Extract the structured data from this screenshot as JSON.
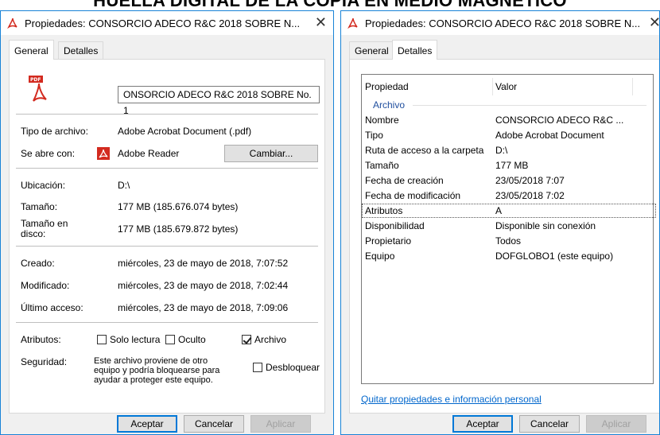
{
  "banner": "HUELLA DIGITAL DE LA COPIA EN MEDIO MAGNÉTICO",
  "left_window": {
    "title": "Propiedades: CONSORCIO ADECO R&C 2018 SOBRE N...",
    "tabs": [
      "General",
      "Detalles"
    ],
    "file_name": "ONSORCIO ADECO R&C 2018 SOBRE No. 1",
    "rows": {
      "tipo_label": "Tipo de archivo:",
      "tipo_value": "Adobe Acrobat Document (.pdf)",
      "abre_label": "Se abre con:",
      "abre_value": "Adobe Reader",
      "cambiar_button": "Cambiar...",
      "ubicacion_label": "Ubicación:",
      "ubicacion_value": "D:\\",
      "tamano_label": "Tamaño:",
      "tamano_value": "177 MB (185.676.074 bytes)",
      "tamano_disco_label_1": "Tamaño en",
      "tamano_disco_label_2": "disco:",
      "tamano_disco_value": "177 MB (185.679.872 bytes)",
      "creado_label": "Creado:",
      "creado_value": "miércoles, 23 de mayo de 2018, 7:07:52",
      "modificado_label": "Modificado:",
      "modificado_value": "miércoles, 23 de mayo de 2018, 7:02:44",
      "acceso_label": "Último acceso:",
      "acceso_value": "miércoles, 23 de mayo de 2018, 7:09:06",
      "atributos_label": "Atributos:",
      "solo_lectura": "Solo lectura",
      "oculto": "Oculto",
      "archivo": "Archivo",
      "seguridad_label": "Seguridad:",
      "seguridad_text_1": "Este archivo proviene de otro",
      "seguridad_text_2": "equipo y podría bloquearse para",
      "seguridad_text_3": "ayudar a proteger este equipo.",
      "desbloquear": "Desbloquear"
    },
    "buttons": {
      "aceptar": "Aceptar",
      "cancelar": "Cancelar",
      "aplicar": "Aplicar"
    }
  },
  "right_window": {
    "title": "Propiedades: CONSORCIO ADECO R&C 2018 SOBRE N...",
    "tabs": [
      "General",
      "Detalles"
    ],
    "header": {
      "propiedad": "Propiedad",
      "valor": "Valor"
    },
    "section": "Archivo",
    "rows": [
      {
        "k": "Nombre",
        "v": "CONSORCIO ADECO R&C ..."
      },
      {
        "k": "Tipo",
        "v": "Adobe Acrobat Document"
      },
      {
        "k": "Ruta de acceso a la carpeta",
        "v": "D:\\"
      },
      {
        "k": "Tamaño",
        "v": "177 MB"
      },
      {
        "k": "Fecha de creación",
        "v": "23/05/2018 7:07"
      },
      {
        "k": "Fecha de modificación",
        "v": "23/05/2018 7:02"
      },
      {
        "k": "Atributos",
        "v": "A"
      },
      {
        "k": "Disponibilidad",
        "v": "Disponible sin conexión"
      },
      {
        "k": "Propietario",
        "v": "Todos"
      },
      {
        "k": "Equipo",
        "v": "DOFGLOBO1 (este equipo)"
      }
    ],
    "link": "Quitar propiedades e información personal",
    "buttons": {
      "aceptar": "Aceptar",
      "cancelar": "Cancelar",
      "aplicar": "Aplicar"
    }
  },
  "colors": {
    "accent": "#0078d7",
    "pdf_red": "#d32a1f",
    "link": "#0066cc"
  },
  "icons": [
    "pdf-icon",
    "adobe-reader-icon",
    "close-icon"
  ]
}
